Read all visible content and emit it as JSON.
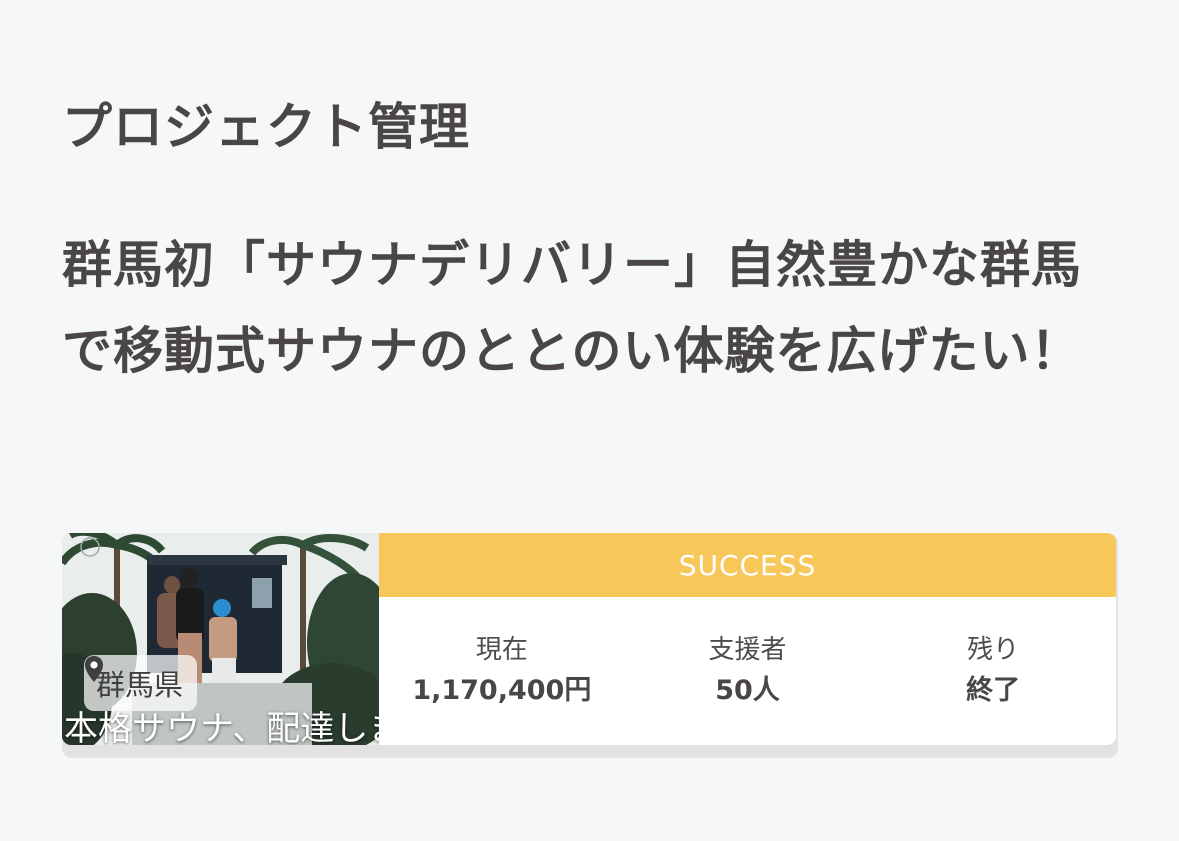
{
  "header": {
    "title": "プロジェクト管理"
  },
  "project": {
    "title": "群馬初「サウナデリバリー」自然豊かな群馬で移動式サウナのととのい体験を広げたい！",
    "location": "群馬県",
    "image_caption": "本格サウナ、配達します。",
    "status": "SUCCESS",
    "status_color": "#f8c75a",
    "stats": {
      "current_label": "現在",
      "current_value": "1,170,400円",
      "supporters_label": "支援者",
      "supporters_value": "50人",
      "remaining_label": "残り",
      "remaining_value": "終了"
    }
  }
}
